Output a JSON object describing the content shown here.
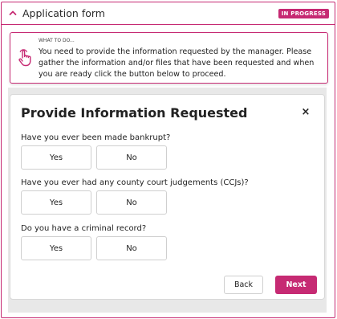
{
  "header": {
    "title": "Application form",
    "status_badge": "IN PROGRESS",
    "accent_color": "#c62a73"
  },
  "notice": {
    "label": "WHAT TO DO...",
    "text": "You need to provide the information requested by the manager. Please gather the information and/or files that have been requested and when you are ready click the button below to proceed.",
    "icon": "hand-pointer-icon"
  },
  "dialog": {
    "title": "Provide Information Requested",
    "close_symbol": "×",
    "questions": [
      {
        "text": "Have you ever been made bankrupt?",
        "yes": "Yes",
        "no": "No"
      },
      {
        "text": "Have you ever had any county court judgements (CCJs)?",
        "yes": "Yes",
        "no": "No"
      },
      {
        "text": "Do you have a criminal record?",
        "yes": "Yes",
        "no": "No"
      }
    ],
    "back_label": "Back",
    "next_label": "Next"
  }
}
